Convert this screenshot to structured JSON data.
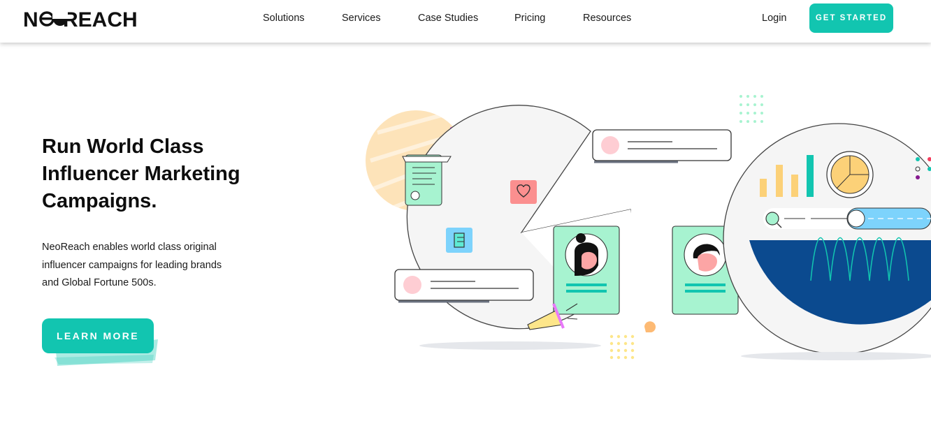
{
  "brand": {
    "logo_text": "NEOREACH",
    "accent": "#12c5b0"
  },
  "nav": {
    "items": [
      {
        "label": "Solutions"
      },
      {
        "label": "Services"
      },
      {
        "label": "Case Studies"
      },
      {
        "label": "Pricing"
      },
      {
        "label": "Resources"
      }
    ],
    "login_label": "Login",
    "cta_label": "GET STARTED"
  },
  "hero": {
    "title_lines": [
      "Run World Class",
      "Influencer Marketing",
      "Campaigns."
    ],
    "description_lines": [
      "NeoReach enables world class original",
      "influencer campaigns for leading brands",
      "and Global Fortune 500s."
    ],
    "cta_label": "LEARN MORE"
  },
  "illustration": {
    "icons": [
      "document-icon",
      "heart-icon",
      "thumbs-up-icon",
      "megaphone-icon",
      "search-icon",
      "pie-chart-icon",
      "bar-chart-icon"
    ]
  }
}
